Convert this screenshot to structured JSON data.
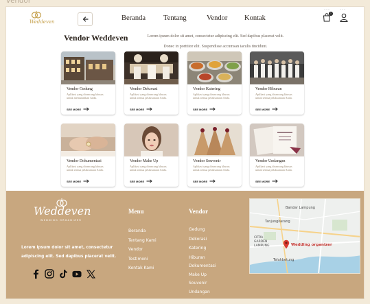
{
  "tab": {
    "label": "vendor"
  },
  "header": {
    "brand": "Weddeven",
    "nav": [
      "Beranda",
      "Tentang",
      "Vendor",
      "Kontak"
    ],
    "cart_count": "1"
  },
  "intro": {
    "title": "Vendor Weddeven",
    "line1": "Lorem ipsum dolor sit amet, consectetur adipiscing elit. Sed dapibus placerat velit.",
    "line2": "Donec in porttitor elit. Suspendisse accumsan iaculis tincidunt."
  },
  "cards": [
    {
      "title": "Vendor Gedung",
      "desc": "Aplikasi yang dirancang khusus untuk memudahkan Anda.",
      "more": "SEE MORE",
      "photo": "building-photo"
    },
    {
      "title": "Vendor Dekorasi",
      "desc": "Aplikasi yang dirancang khusus untuk semua pelaksanaan Anda.",
      "more": "SEE MORE",
      "photo": "decoration-photo"
    },
    {
      "title": "Vendor Katering",
      "desc": "Aplikasi yang dirancang khusus untuk semua pelaksanaan Anda.",
      "more": "SEE MORE",
      "photo": "catering-photo"
    },
    {
      "title": "Vendor Hiburan",
      "desc": "Aplikasi yang dirancang khusus untuk semua pelaksanaan Anda.",
      "more": "SEE MORE",
      "photo": "entertainment-photo"
    },
    {
      "title": "Vendor Dokumentasi",
      "desc": "Aplikasi yang dirancang khusus untuk semua pelaksanaan Anda.",
      "more": "SEE MORE",
      "photo": "documentation-photo"
    },
    {
      "title": "Vendor Make Up",
      "desc": "Aplikasi yang dirancang khusus untuk semua pelaksanaan Anda.",
      "more": "SEE MORE",
      "photo": "makeup-photo"
    },
    {
      "title": "Vendor Souvenir",
      "desc": "Aplikasi yang dirancang khusus untuk semua pelaksanaan Anda.",
      "more": "SEE MORE",
      "photo": "souvenir-photo"
    },
    {
      "title": "Vendor Undangan",
      "desc": "Aplikasi yang dirancang khusus untuk semua pelaksanaan Anda.",
      "more": "SEE MORE",
      "photo": "invitation-photo"
    }
  ],
  "footer": {
    "brand": "Weddeven",
    "brand_sub": "WEDDING ORGANIZER",
    "about": "Lorem ipsum dolor sit amet, consectetur adipiscing elit. Sed dapibus placerat velit.",
    "menu_heading": "Menu",
    "menu_items": [
      "Beranda",
      "Tentang Kami",
      "Vendor",
      "Testimoni",
      "Kontak Kami"
    ],
    "vendor_heading": "Vendor",
    "vendor_items": [
      "Gedung",
      "Dekorasi",
      "Katering",
      "Hiburan",
      "Dokumentasi",
      "Make Up",
      "Souvenir",
      "Undangan"
    ],
    "socials": [
      "facebook-icon",
      "instagram-icon",
      "tiktok-icon",
      "youtube-icon",
      "x-icon"
    ],
    "map": {
      "labels": [
        "Bandar Lampung",
        "Tanjungkarang",
        "CITRA GARDEN LAMPUNG",
        "Telukbetung"
      ],
      "pin_label": "Wedding organizer"
    }
  },
  "colors": {
    "footer_bg": "#c8a77f",
    "page_bg": "#f3ead9",
    "accent_gold": "#c6a24f"
  }
}
